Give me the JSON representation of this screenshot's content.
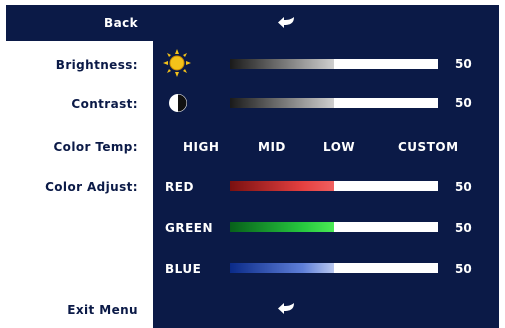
{
  "header": {
    "back_label": "Back",
    "back_icon": "return-arrow-icon"
  },
  "labels": {
    "brightness": "Brightness:",
    "contrast": "Contrast:",
    "color_temp": "Color Temp:",
    "color_adjust": "Color Adjust:",
    "exit_menu": "Exit Menu"
  },
  "brightness": {
    "icon": "sun-icon",
    "value": "50",
    "level": 0.5
  },
  "contrast": {
    "icon": "contrast-icon",
    "value": "50",
    "level": 0.5
  },
  "color_temp_options": [
    "HIGH",
    "MID",
    "LOW",
    "CUSTOM"
  ],
  "color_adjust": [
    {
      "label": "RED",
      "value": "50",
      "level": 0.5,
      "color": "#e54040"
    },
    {
      "label": "GREEN",
      "value": "50",
      "level": 0.5,
      "color": "#27c83f"
    },
    {
      "label": "BLUE",
      "value": "50",
      "level": 0.5,
      "color": "#5f7fd8"
    }
  ],
  "exit_icon": "return-arrow-icon",
  "colors": {
    "panel": "#0b1a47",
    "label_text": "#0b1a47",
    "panel_text": "#ffffff",
    "icon_yellow": "#f4c21a"
  }
}
